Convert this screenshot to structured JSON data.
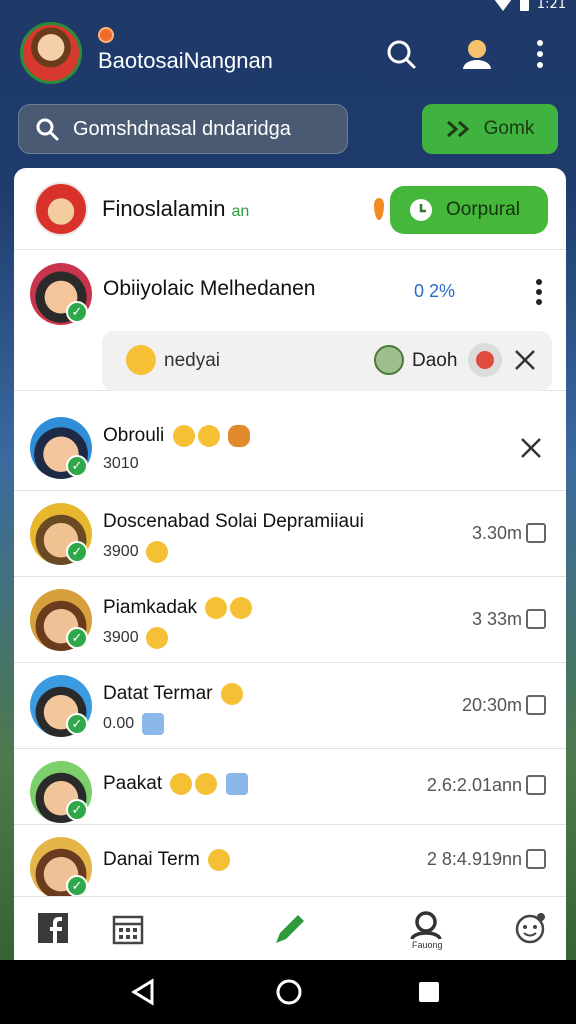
{
  "status_bar": {
    "time": "1:21"
  },
  "header": {
    "title": "BaotosaiNangnan",
    "icons": [
      "avatar",
      "notification-dot",
      "search-icon",
      "profile-icon",
      "more-vert-icon"
    ]
  },
  "search": {
    "label": "Gomshdnasal dndaridga",
    "button_label": "Gomk"
  },
  "top_contact": {
    "name": "Finoslalamin",
    "tag": "an",
    "button_label": "Oorpural"
  },
  "chats": [
    {
      "name": "Obiiyolaic Melhedanen",
      "pct": "2%",
      "reply_text": "nedyai",
      "reply_label2": "Daoh"
    },
    {
      "name": "Obrouli",
      "sub": "3010",
      "emojis": [
        "smile",
        "smile",
        "orange"
      ]
    },
    {
      "name": "Doscenabad Solai Depramiiaui",
      "sub": "3900",
      "time": "3.30m"
    },
    {
      "name": "Piamkadak",
      "sub": "3900",
      "time": "3 33m"
    },
    {
      "name": "Datat Termar",
      "sub": "0.00",
      "time": "20:30m"
    },
    {
      "name": "Paakat",
      "time": "2.6:2.01ann"
    },
    {
      "name": "Danai Term",
      "time": "2 8:4.919nn"
    }
  ],
  "bottom_nav": {
    "items": [
      "facebook-icon",
      "calendar-icon",
      "edit-icon",
      "profile-icon",
      "sticker-icon"
    ],
    "profile_label": "Fauong"
  }
}
